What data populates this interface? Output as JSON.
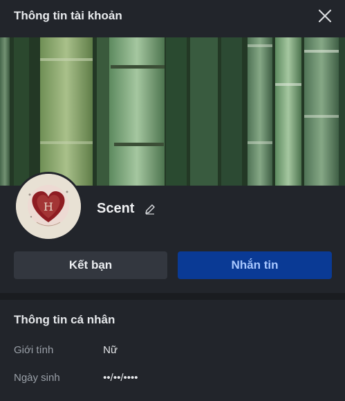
{
  "header": {
    "title": "Thông tin tài khoản"
  },
  "profile": {
    "name": "Scent",
    "avatar_letter": "H"
  },
  "actions": {
    "add_friend_label": "Kết bạn",
    "message_label": "Nhắn tin"
  },
  "personal_info": {
    "section_title": "Thông tin cá nhân",
    "rows": [
      {
        "label": "Giới tính",
        "value": "Nữ"
      },
      {
        "label": "Ngày sinh",
        "value": "••/••/••••"
      }
    ]
  },
  "colors": {
    "background": "#22252b",
    "message_button": "#0a3a95",
    "message_text": "#a9c8ff",
    "friend_button": "#33373f"
  },
  "icons": {
    "close": "close-icon",
    "edit": "pencil-icon"
  }
}
